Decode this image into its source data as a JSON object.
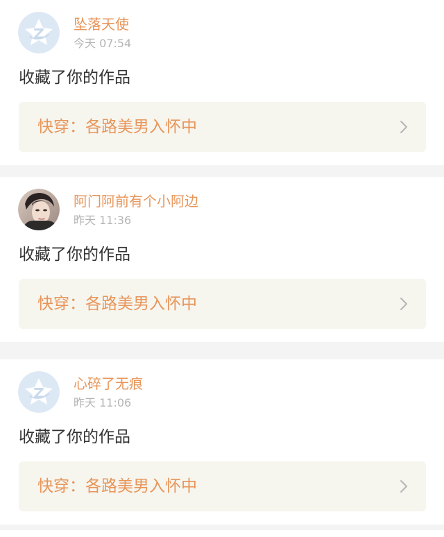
{
  "notifications": [
    {
      "username": "坠落天使",
      "timestamp": "今天 07:54",
      "message": "收藏了你的作品",
      "work_title": "快穿：各路美男入怀中",
      "avatar_icon": "default-qzone-star-icon"
    },
    {
      "username": "阿门阿前有个小阿边",
      "timestamp": "昨天 11:36",
      "message": "收藏了你的作品",
      "work_title": "快穿：各路美男入怀中",
      "avatar_icon": "user-photo"
    },
    {
      "username": "心碎了无痕",
      "timestamp": "昨天 11:06",
      "message": "收藏了你的作品",
      "work_title": "快穿：各路美男入怀中",
      "avatar_icon": "default-qzone-star-icon"
    }
  ],
  "colors": {
    "accent": "#e8955a",
    "timestamp": "#b4b4b4",
    "message": "#333333",
    "link_background": "#f6f5ee",
    "divider": "#f4f4f4",
    "default_avatar": "#dde8f5"
  }
}
